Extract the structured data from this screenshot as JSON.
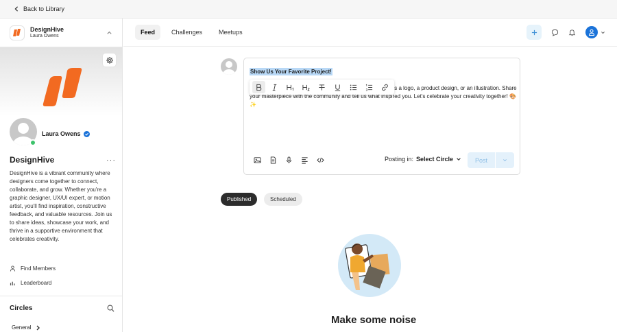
{
  "topbar": {
    "back_label": "Back to Library"
  },
  "community": {
    "name": "DesignHive",
    "owner": "Laura Owens",
    "profile_name": "Laura Owens",
    "title": "DesignHive",
    "description": "DesignHive is a vibrant community where designers come together to connect, collaborate, and grow. Whether you're a graphic designer, UX/UI expert, or motion artist, you'll find inspiration, constructive feedback, and valuable resources. Join us to share ideas, showcase your work, and thrive in a supportive environment that celebrates creativity.",
    "brand_color": "#f26a21"
  },
  "sidebar_nav": {
    "find_members": "Find Members",
    "leaderboard": "Leaderboard"
  },
  "circles": {
    "title": "Circles",
    "general": "General"
  },
  "tabs": {
    "feed": "Feed",
    "challenges": "Challenges",
    "meetups": "Meetups"
  },
  "composer": {
    "title": "Show Us Your Favorite Project!",
    "body": "Pick your favorite design project and show it off—whether it's a logo, a product design, or an illustration. Share your masterpiece with the community and tell us what inspired you. Let's celebrate your creativity together! 🎨✨",
    "posting_in_label": "Posting in:",
    "circle_select": "Select Circle",
    "post_label": "Post"
  },
  "filters": {
    "published": "Published",
    "scheduled": "Scheduled"
  },
  "empty_state": {
    "title": "Make some noise"
  },
  "colors": {
    "accent": "#1b73d9",
    "online": "#3cc26b"
  }
}
